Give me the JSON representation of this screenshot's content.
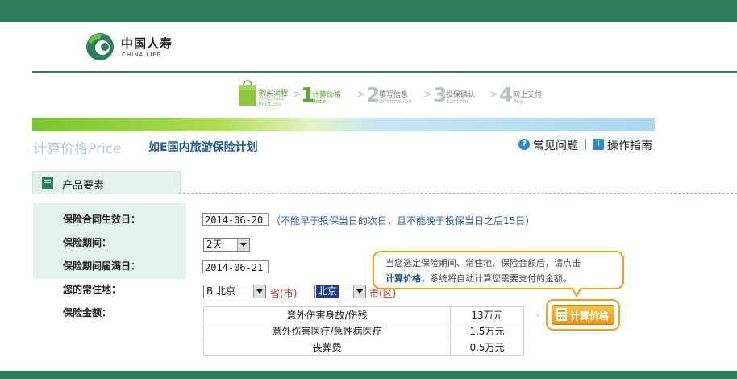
{
  "brand": {
    "name_cn": "中国人寿",
    "name_en": "CHINA LIFE"
  },
  "steps": {
    "process_cn": "购买流程",
    "process_en_1": "PURCHASE",
    "process_en_2": "PROCESS",
    "items": [
      {
        "num": "1",
        "cn": "计算价格",
        "en": "Price",
        "active": true
      },
      {
        "num": "2",
        "cn": "填写信息",
        "en": "Information",
        "active": false
      },
      {
        "num": "3",
        "cn": "投保确认",
        "en": "Confirm",
        "active": false
      },
      {
        "num": "4",
        "cn": "网上支付",
        "en": "Pay",
        "active": false
      }
    ],
    "separator": ">"
  },
  "header": {
    "page_title": "计算价格Price",
    "plan_name": "如E国内旅游保险计划",
    "faq_label": "常见问题",
    "guide_label": "操作指南"
  },
  "section": {
    "tab_label": "产品要素"
  },
  "form": {
    "effective_date_label": "保险合同生效日：",
    "effective_date_value": "2014-06-20",
    "effective_date_hint": "（不能早于投保当日的次日，且不能晚于投保当日之后15日）",
    "period_label": "保险期间：",
    "period_value": "2天",
    "expiry_date_label": "保险期间届满日：",
    "expiry_date_value": "2014-06-21",
    "residence_label": "您的常住地：",
    "province_value": "B 北京",
    "province_unit": "省(市)",
    "city_value": "北京",
    "city_unit": "市(区)",
    "amount_label": "保险金额："
  },
  "coverage": [
    {
      "item": "意外伤害身故/伤残",
      "amount": "13万元"
    },
    {
      "item": "意外伤害医疗/急性病医疗",
      "amount": "1.5万元"
    },
    {
      "item": "丧葬费",
      "amount": "0.5万元"
    }
  ],
  "tooltip": {
    "line1": "当您选定保险期间、常住地、保险金额后，请点击",
    "emphasis": "计算价格",
    "line2_rest": "，系统将自动计算您需要支付的金额。"
  },
  "calc_button": {
    "label": "计算价格"
  },
  "colors": {
    "brand_green": "#2e7d5b",
    "accent_orange": "#f0a020",
    "link_blue": "#1f5a8a"
  }
}
